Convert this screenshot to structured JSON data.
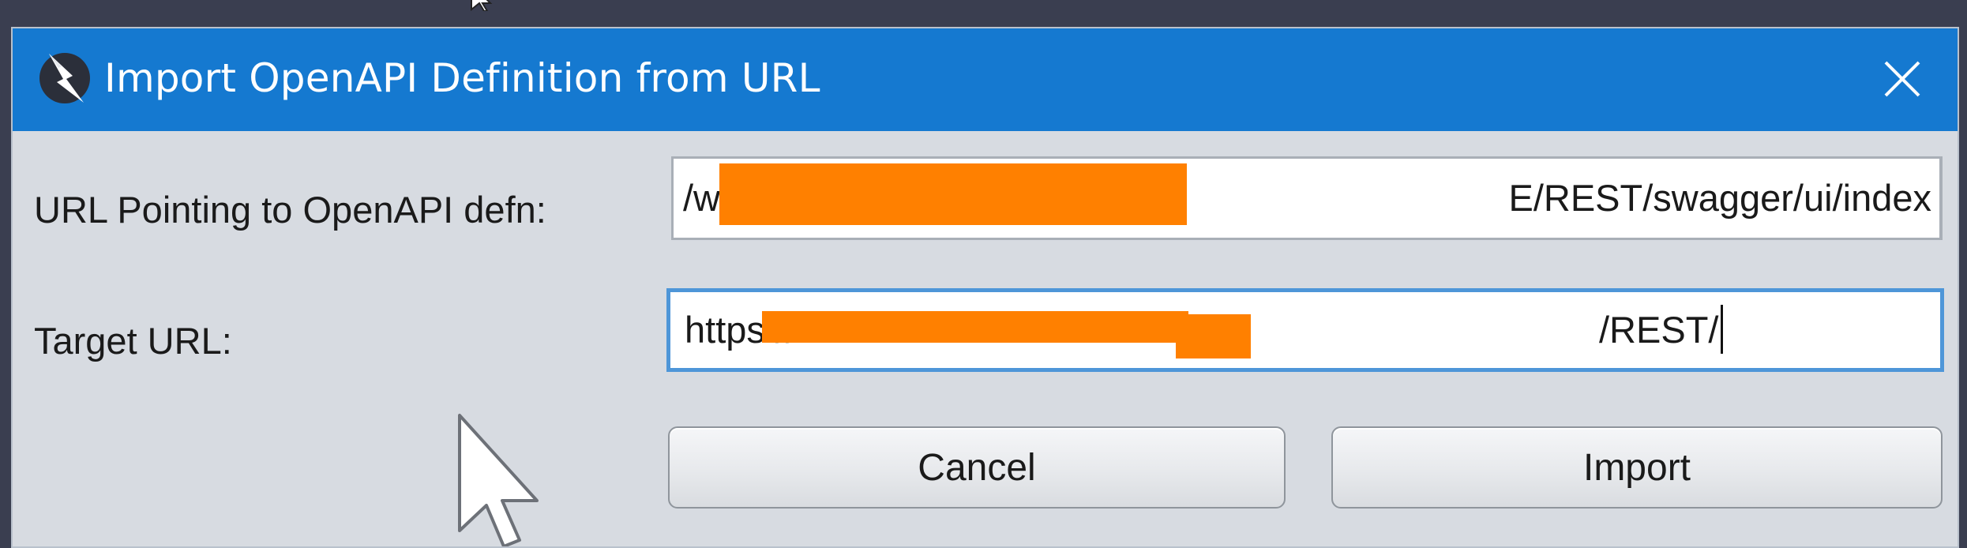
{
  "dialog": {
    "title": "Import OpenAPI Definition from URL",
    "app_icon": "lightning-bolt-app-icon",
    "close_icon": "close-x-icon"
  },
  "fields": {
    "openapi_url": {
      "label": "URL Pointing to OpenAPI defn:",
      "value_start": "/w",
      "value_end": "E/REST/swagger/ui/index",
      "redacted": true
    },
    "target_url": {
      "label": "Target URL:",
      "value_start": "https://",
      "value_end": "/REST/",
      "redacted": true,
      "focused": true
    }
  },
  "buttons": {
    "cancel": "Cancel",
    "import": "Import"
  },
  "colors": {
    "titlebar": "#1579d0",
    "dialog_bg": "#d7dbe1",
    "focus_border": "#4e96d8",
    "redaction": "#ff8000",
    "backdrop": "#3a3e50"
  }
}
